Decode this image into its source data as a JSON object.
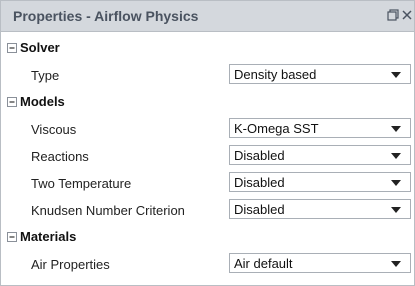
{
  "panel": {
    "title": "Properties - Airflow Physics"
  },
  "sections": [
    {
      "label": "Solver"
    },
    {
      "label": "Models"
    },
    {
      "label": "Materials"
    }
  ],
  "rows": [
    {
      "label": "Type",
      "value": "Density based"
    },
    {
      "label": "Viscous",
      "value": "K-Omega SST"
    },
    {
      "label": "Reactions",
      "value": "Disabled"
    },
    {
      "label": "Two Temperature",
      "value": "Disabled"
    },
    {
      "label": "Knudsen Number Criterion",
      "value": "Disabled"
    },
    {
      "label": "Air Properties",
      "value": "Air default"
    }
  ],
  "icons": {
    "restore": "window-restore-icon",
    "close": "close-icon",
    "collapse": "minus-box-icon",
    "dropdown": "chevron-down-icon"
  },
  "colors": {
    "titlebar_bg": "#d4d8dd",
    "title_text": "#4a5360",
    "border": "#b9bec4"
  }
}
